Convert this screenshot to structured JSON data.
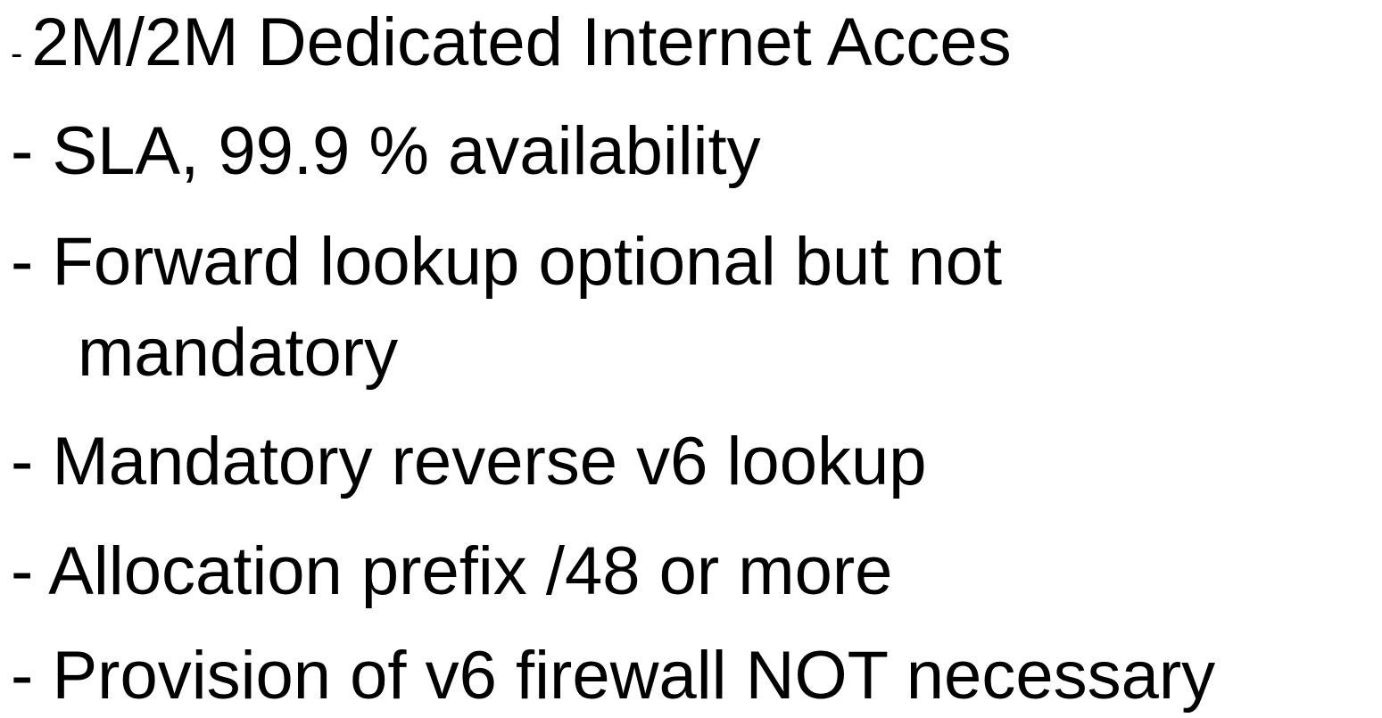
{
  "bullets": [
    {
      "marker": "-",
      "text": "2M/2M Dedicated Internet Acces"
    },
    {
      "marker": "-",
      "text": "SLA, 99.9 % availability"
    },
    {
      "marker": "-",
      "text": "Forward lookup optional but not",
      "continuation": "mandatory"
    },
    {
      "marker": "-",
      "text": "Mandatory reverse v6 lookup"
    },
    {
      "marker": "-",
      "text": "Allocation prefix /48 or more"
    },
    {
      "marker": "-",
      "text": "Provision of v6 firewall NOT necessary"
    }
  ]
}
